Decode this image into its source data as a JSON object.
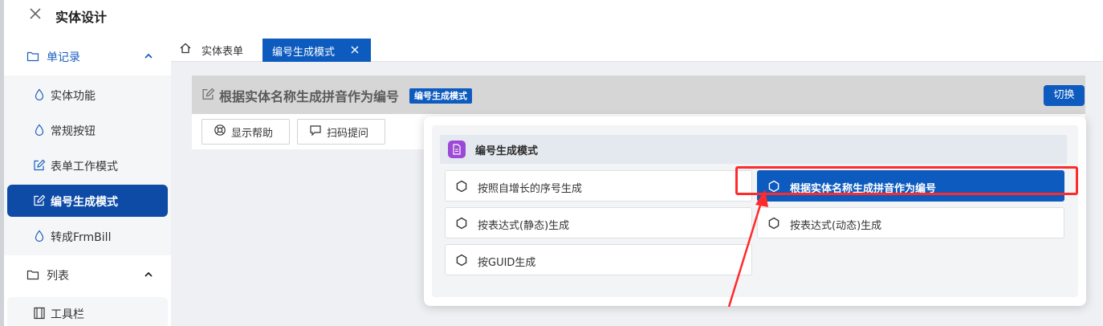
{
  "header": {
    "title": "实体设计"
  },
  "sidebar": {
    "groups": [
      {
        "label": "单记录",
        "items": [
          {
            "label": "实体功能",
            "icon": "drop-icon"
          },
          {
            "label": "常规按钮",
            "icon": "drop-icon"
          },
          {
            "label": "表单工作模式",
            "icon": "edit-icon"
          },
          {
            "label": "编号生成模式",
            "icon": "edit-icon",
            "active": true
          },
          {
            "label": "转成FrmBill",
            "icon": "drop-icon"
          }
        ]
      },
      {
        "label": "列表",
        "items": [
          {
            "label": "工具栏",
            "icon": "film-icon"
          }
        ]
      }
    ]
  },
  "tabs": [
    {
      "label": "实体表单",
      "icon": "home-icon"
    },
    {
      "label": "编号生成模式",
      "active": true
    }
  ],
  "content": {
    "title": "根据实体名称生成拼音作为编号",
    "badge": "编号生成模式",
    "switch_label": "切换",
    "toolbar": [
      {
        "label": "显示帮助",
        "icon": "lifebuoy-icon"
      },
      {
        "label": "扫码提问",
        "icon": "chat-icon"
      }
    ]
  },
  "popup": {
    "title": "编号生成模式",
    "options": [
      {
        "label": "按照自增长的序号生成"
      },
      {
        "label": "根据实体名称生成拼音作为编号",
        "selected": true
      },
      {
        "label": "按表达式(静态)生成"
      },
      {
        "label": "按表达式(动态)生成"
      },
      {
        "label": "按GUID生成"
      }
    ]
  },
  "colors": {
    "primary": "#0d5bbf",
    "sidebar_active": "#0d4ba7",
    "annotation": "#ff2a2a",
    "doc_icon": "#9b49d6"
  }
}
